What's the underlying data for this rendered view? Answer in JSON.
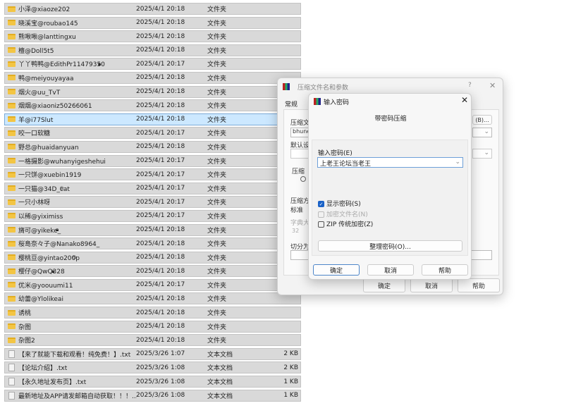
{
  "files": [
    {
      "name": "小泽@xiaoze202",
      "date": "2025/4/1 20:18",
      "type": "文件夹",
      "size": "",
      "kind": "folder"
    },
    {
      "name": "晓溪宝@roubao145",
      "date": "2025/4/1 20:18",
      "type": "文件夹",
      "size": "",
      "kind": "folder"
    },
    {
      "name": "熊啾啾@lanttingxu",
      "date": "2025/4/1 20:18",
      "type": "文件夹",
      "size": "",
      "kind": "folder"
    },
    {
      "name": "檀@Doll5t5",
      "date": "2025/4/1 20:18",
      "type": "文件夹",
      "size": "",
      "kind": "folder"
    },
    {
      "name": "丫丫鸭鸭@EdithPr11479350",
      "date": "2025/4/1 20:17",
      "type": "文件夹",
      "size": "",
      "kind": "folder",
      "badge": "lock"
    },
    {
      "name": "鸭@meiyouyayaa",
      "date": "2025/4/1 20:18",
      "type": "文件夹",
      "size": "",
      "kind": "folder"
    },
    {
      "name": "烟火@uu_TvT",
      "date": "2025/4/1 20:18",
      "type": "文件夹",
      "size": "",
      "kind": "folder"
    },
    {
      "name": "烟烟@xiaoniz50266061",
      "date": "2025/4/1 20:18",
      "type": "文件夹",
      "size": "",
      "kind": "folder"
    },
    {
      "name": "羊@i77Slut",
      "date": "2025/4/1 20:18",
      "type": "文件夹",
      "size": "",
      "kind": "folder",
      "selected": true
    },
    {
      "name": "咬一口软糖",
      "date": "2025/4/1 20:17",
      "type": "文件夹",
      "size": "",
      "kind": "folder"
    },
    {
      "name": "野总@huaidanyuan",
      "date": "2025/4/1 20:18",
      "type": "文件夹",
      "size": "",
      "kind": "folder"
    },
    {
      "name": "一格摄影@wuhanyigeshehui",
      "date": "2025/4/1 20:17",
      "type": "文件夹",
      "size": "",
      "kind": "folder"
    },
    {
      "name": "一只饼@xuebin1919",
      "date": "2025/4/1 20:17",
      "type": "文件夹",
      "size": "",
      "kind": "folder"
    },
    {
      "name": "一只猫@34D_cat",
      "date": "2025/4/1 20:17",
      "type": "文件夹",
      "size": "",
      "kind": "folder",
      "badge": "blocked"
    },
    {
      "name": "一只小林呀",
      "date": "2025/4/1 20:17",
      "type": "文件夹",
      "size": "",
      "kind": "folder"
    },
    {
      "name": "以稀@yiximiss",
      "date": "2025/4/1 20:17",
      "type": "文件夹",
      "size": "",
      "kind": "folder"
    },
    {
      "name": "旖可@yikeke_",
      "date": "2025/4/1 20:18",
      "type": "文件夹",
      "size": "",
      "kind": "folder",
      "badge": "lock"
    },
    {
      "name": "桜島奈々子@Nanako8964_",
      "date": "2025/4/1 20:18",
      "type": "文件夹",
      "size": "",
      "kind": "folder"
    },
    {
      "name": "樱桃豆@yintao200p",
      "date": "2025/4/1 20:18",
      "type": "文件夹",
      "size": "",
      "kind": "folder",
      "badge": "blocked"
    },
    {
      "name": "樱仔@QwQ328",
      "date": "2025/4/1 20:18",
      "type": "文件夹",
      "size": "",
      "kind": "folder",
      "badge": "lock"
    },
    {
      "name": "优米@yoouumi11",
      "date": "2025/4/1 20:17",
      "type": "文件夹",
      "size": "",
      "kind": "folder"
    },
    {
      "name": "幼蕾@Ylolikeai",
      "date": "2025/4/1 20:18",
      "type": "文件夹",
      "size": "",
      "kind": "folder"
    },
    {
      "name": "诱桃",
      "date": "2025/4/1 20:18",
      "type": "文件夹",
      "size": "",
      "kind": "folder"
    },
    {
      "name": "杂图",
      "date": "2025/4/1 20:18",
      "type": "文件夹",
      "size": "",
      "kind": "folder"
    },
    {
      "name": "杂图2",
      "date": "2025/4/1 20:18",
      "type": "文件夹",
      "size": "",
      "kind": "folder"
    },
    {
      "name": "【来了就能下载和观看！纯免费！】.txt",
      "date": "2025/3/26 1:07",
      "type": "文本文档",
      "size": "2 KB",
      "kind": "file"
    },
    {
      "name": "【论坛介绍】.txt",
      "date": "2025/3/26 1:08",
      "type": "文本文档",
      "size": "2 KB",
      "kind": "file"
    },
    {
      "name": "【永久地址发布页】.txt",
      "date": "2025/3/26 1:08",
      "type": "文本文档",
      "size": "1 KB",
      "kind": "file"
    },
    {
      "name": "最新地址及APP请发邮箱自动获取！！！....",
      "date": "2025/3/26 1:08",
      "type": "文本文档",
      "size": "1 KB",
      "kind": "file"
    }
  ],
  "back_dialog": {
    "title": "压缩文件名和参数",
    "help": "?",
    "close": "✕",
    "tab": "常规",
    "archive_label": "压缩文",
    "archive_value": "bhune",
    "browse": "(B)...",
    "default_label": "默认设",
    "format_label": "压缩",
    "method_label": "压缩方",
    "method_value": "标准",
    "dict_label": "字典大",
    "dict_value": "32",
    "split_label": "切分为",
    "ok": "确定",
    "cancel": "取消",
    "help_btn": "帮助"
  },
  "password_dialog": {
    "title": "输入密码",
    "close": "✕",
    "heading": "带密码压缩",
    "enter_label": "输入密码(E)",
    "password_value": "上老王论坛当老王",
    "show_password": "显示密码(S)",
    "show_password_checked": true,
    "encrypt_names": "加密文件名(N)",
    "encrypt_names_checked": false,
    "zip_legacy": "ZIP 传统加密(Z)",
    "zip_legacy_checked": false,
    "organize": "整理密码(O)...",
    "ok": "确定",
    "cancel": "取消",
    "help": "帮助"
  }
}
